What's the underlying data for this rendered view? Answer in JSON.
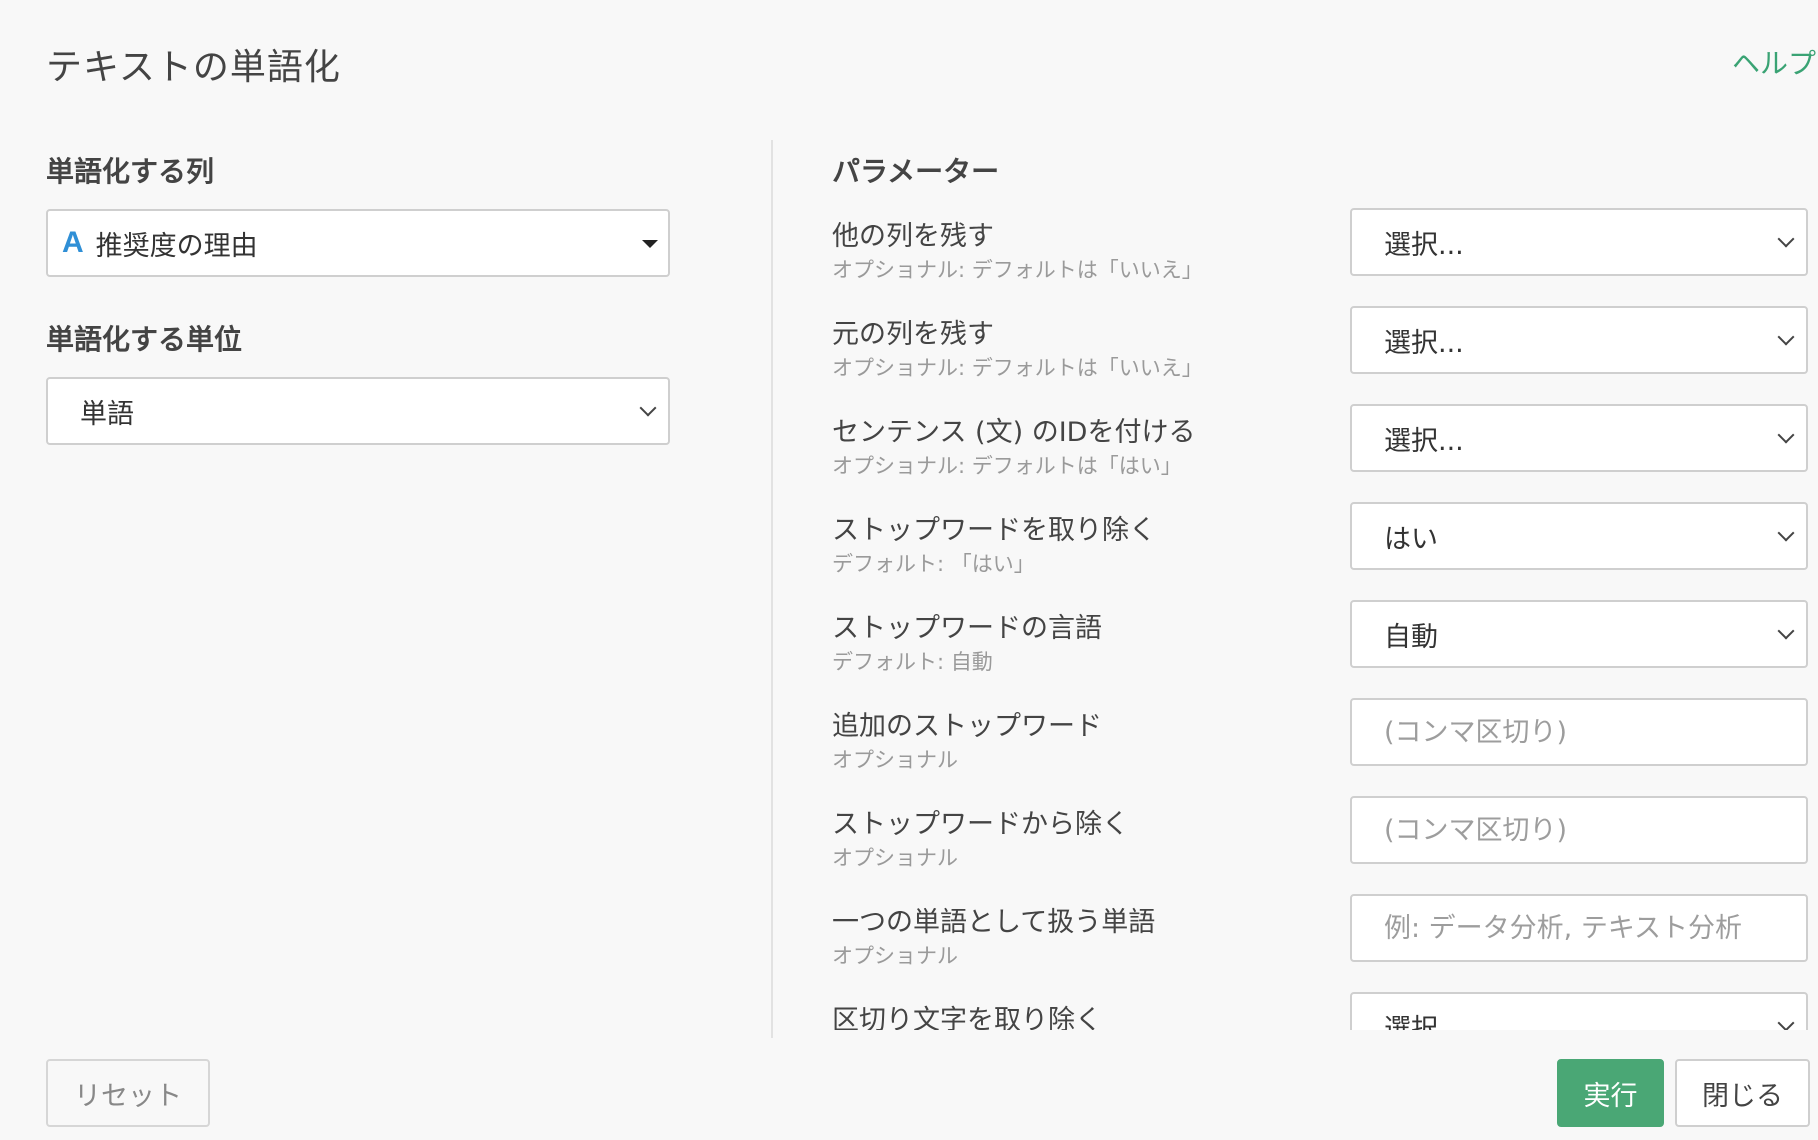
{
  "dialog": {
    "title": "テキストの単語化",
    "help_label": "ヘルプ"
  },
  "left_panel": {
    "column_label": "単語化する列",
    "column_type_icon": "A",
    "column_value": "推奨度の理由",
    "unit_label": "単語化する単位",
    "unit_value": "単語"
  },
  "parameters": {
    "header": "パラメーター",
    "items": [
      {
        "name": "他の列を残す",
        "hint": "オプショナル: デフォルトは「いいえ」",
        "control": "select",
        "value": "選択..."
      },
      {
        "name": "元の列を残す",
        "hint": "オプショナル: デフォルトは「いいえ」",
        "control": "select",
        "value": "選択..."
      },
      {
        "name": "センテンス (文) のIDを付ける",
        "hint": "オプショナル: デフォルトは「はい」",
        "control": "select",
        "value": "選択..."
      },
      {
        "name": "ストップワードを取り除く",
        "hint": "デフォルト: 「はい」",
        "control": "select",
        "value": "はい"
      },
      {
        "name": "ストップワードの言語",
        "hint": "デフォルト: 自動",
        "control": "select",
        "value": "自動"
      },
      {
        "name": "追加のストップワード",
        "hint": "オプショナル",
        "control": "input",
        "value": "",
        "placeholder": "(コンマ区切り)"
      },
      {
        "name": "ストップワードから除く",
        "hint": "オプショナル",
        "control": "input",
        "value": "",
        "placeholder": "(コンマ区切り)"
      },
      {
        "name": "一つの単語として扱う単語",
        "hint": "オプショナル",
        "control": "input",
        "value": "",
        "placeholder": "例: データ分析, テキスト分析"
      },
      {
        "name": "区切り文字を取り除く",
        "hint": "",
        "control": "select",
        "value": "選択..."
      }
    ]
  },
  "footer": {
    "reset_label": "リセット",
    "run_label": "実行",
    "close_label": "閉じる"
  },
  "colors": {
    "accent": "#4aa775",
    "help_link": "#3aa374",
    "type_icon": "#2f8fd6"
  },
  "icons": {
    "column_type": "string-type-icon",
    "dropdown": "chevron-down-icon",
    "column_dropdown": "caret-down-icon"
  }
}
